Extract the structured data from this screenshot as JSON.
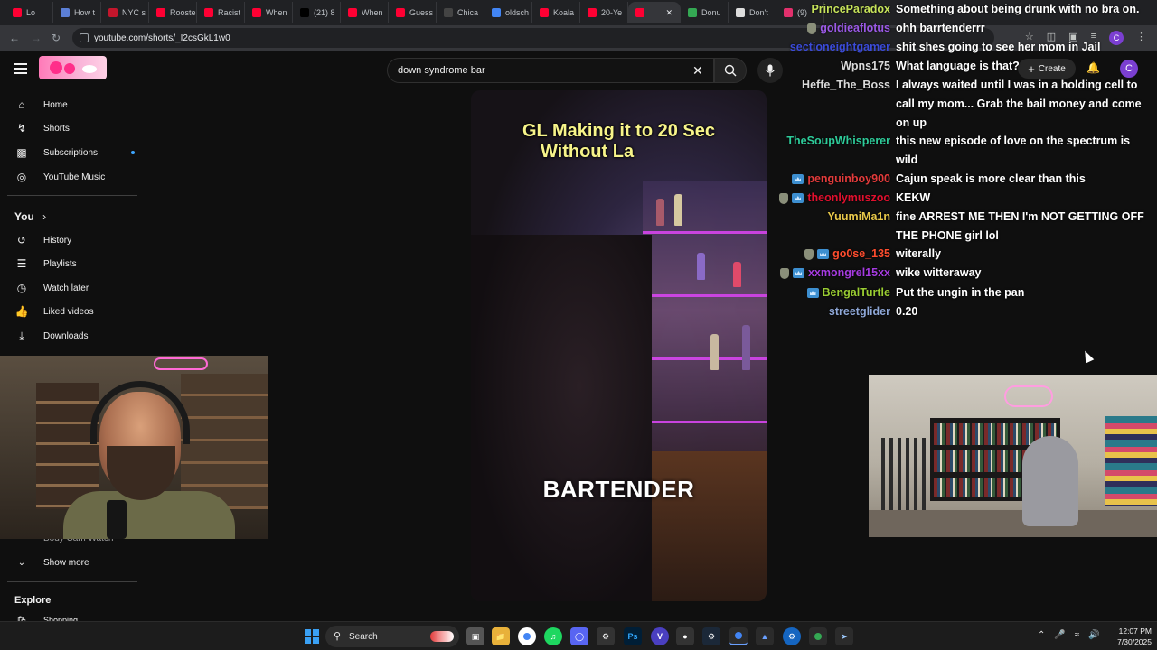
{
  "browser": {
    "tabs": [
      {
        "label": "Lo",
        "color": "#ff0033"
      },
      {
        "label": "How t",
        "color": "#5b7fd6"
      },
      {
        "label": "NYC s",
        "color": "#c3162c"
      },
      {
        "label": "Rooste",
        "color": "#ff0033"
      },
      {
        "label": "Racist",
        "color": "#ff0033"
      },
      {
        "label": "When",
        "color": "#ff0033"
      },
      {
        "label": "(21) 8",
        "color": "#000000"
      },
      {
        "label": "When",
        "color": "#ff0033"
      },
      {
        "label": "Guess",
        "color": "#ff0033"
      },
      {
        "label": "Chica",
        "color": "#444444"
      },
      {
        "label": "oldsch",
        "color": "#4285f4"
      },
      {
        "label": "Koala",
        "color": "#ff0033"
      },
      {
        "label": "20-Ye",
        "color": "#ff0033"
      },
      {
        "label": "",
        "color": "#ff0033",
        "active": true
      },
      {
        "label": "Donu",
        "color": "#34a853"
      },
      {
        "label": "Don't",
        "color": "#dddddd"
      },
      {
        "label": "(9)",
        "color": "#e1306c"
      }
    ],
    "url": "youtube.com/shorts/_I2csGkL1w0"
  },
  "youtube": {
    "search_query": "down syndrome bar",
    "create_label": "Create",
    "avatar_letter": "C"
  },
  "sidebar": {
    "main": [
      {
        "label": "Home",
        "icon": "home-icon"
      },
      {
        "label": "Shorts",
        "icon": "shorts-icon"
      },
      {
        "label": "Subscriptions",
        "icon": "subscriptions-icon"
      },
      {
        "label": "YouTube Music",
        "icon": "music-icon"
      }
    ],
    "you_label": "You",
    "you_items": [
      {
        "label": "History",
        "icon": "history-icon"
      },
      {
        "label": "Playlists",
        "icon": "playlists-icon"
      },
      {
        "label": "Watch later",
        "icon": "clock-icon"
      },
      {
        "label": "Liked videos",
        "icon": "thumbs-up-icon"
      },
      {
        "label": "Downloads",
        "icon": "download-icon"
      }
    ],
    "partial_item": "Body Cam Watch",
    "show_more": "Show more",
    "explore_label": "Explore",
    "partial_explore": "Shopping"
  },
  "video": {
    "caption_top_line1": "GL Making it to 20 Sec",
    "caption_top_line2": "Without La",
    "caption_bottom": "BARTENDER"
  },
  "chat": [
    {
      "name": "PrinceParadox",
      "color": "#c6e35a",
      "message": "Something about being drunk with no bra on.",
      "badges": []
    },
    {
      "name": "goldieaflotus",
      "color": "#9b59e6",
      "message": "ohh barrtenderrr",
      "badges": [
        "shield"
      ]
    },
    {
      "name": "sectioneightgamer",
      "color": "#3b4bd8",
      "message": "shit shes going to see her mom in Jail",
      "badges": []
    },
    {
      "name": "Wpns175",
      "color": "#d9d9d9",
      "message": "What language is that?",
      "badges": []
    },
    {
      "name": "Heffe_The_Boss",
      "color": "#d9d9d9",
      "message": "I always waited until I was in a holding cell to call my mom... Grab the bail money and come on up",
      "badges": []
    },
    {
      "name": "TheSoupWhisperer",
      "color": "#2ecc9a",
      "message": "this new episode of love on the spectrum is wild",
      "badges": []
    },
    {
      "name": "penguinboy900",
      "color": "#e23b3b",
      "message": "Cajun speak is more clear than this",
      "badges": [
        "sub"
      ]
    },
    {
      "name": "theonlymuszoo",
      "color": "#e0102e",
      "message": "KEKW",
      "badges": [
        "shield",
        "sub"
      ]
    },
    {
      "name": "YuumiMa1n",
      "color": "#e8c84a",
      "message": "fine ARREST ME THEN I'm NOT GETTING OFF THE PHONE girl lol",
      "badges": []
    },
    {
      "name": "go0se_135",
      "color": "#ff4d2e",
      "message": "witerally",
      "badges": [
        "shield",
        "sub"
      ]
    },
    {
      "name": "xxmongrel15xx",
      "color": "#a53be0",
      "message": "wike witteraway",
      "badges": [
        "shield",
        "sub"
      ]
    },
    {
      "name": "BengalTurtle",
      "color": "#9acd32",
      "message": "Put the ungin in the pan",
      "badges": [
        "sub"
      ]
    },
    {
      "name": "streetglider",
      "color": "#8fa8d8",
      "message": "0.20",
      "badges": []
    }
  ],
  "taskbar": {
    "search_label": "Search",
    "time": "12:07 PM",
    "date": "7/30/2025"
  }
}
